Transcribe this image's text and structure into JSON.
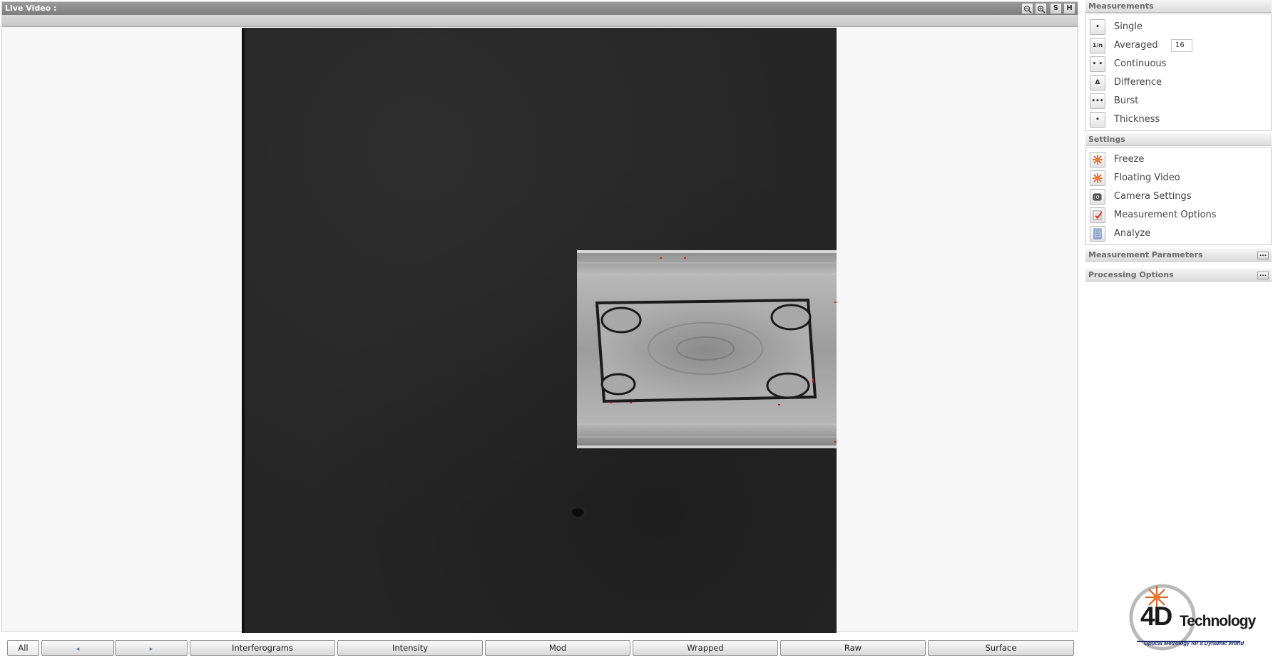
{
  "video": {
    "title": "Live Video :",
    "zoom_out_icon": "zoom-out-icon",
    "zoom_in_icon": "zoom-in-icon",
    "s_label": "S",
    "h_label": "H"
  },
  "tabs": {
    "all": "All",
    "prev": "◂",
    "next": "▸",
    "items": [
      "Interferograms",
      "Intensity",
      "Mod",
      "Wrapped",
      "Raw",
      "Surface"
    ]
  },
  "measurements": {
    "header": "Measurements",
    "items": [
      {
        "label": "Single",
        "icon": "single-dot-icon",
        "glyph": "•"
      },
      {
        "label": "Averaged",
        "icon": "averaged-icon",
        "glyph": "1/n"
      },
      {
        "label": "Continuous",
        "icon": "continuous-icon",
        "glyph": "• •"
      },
      {
        "label": "Difference",
        "icon": "delta-icon",
        "glyph": "Δ"
      },
      {
        "label": "Burst",
        "icon": "burst-icon",
        "glyph": "•••"
      },
      {
        "label": "Thickness",
        "icon": "thickness-icon",
        "glyph": "•"
      }
    ],
    "averaged_count": "16"
  },
  "settings": {
    "header": "Settings",
    "items": [
      {
        "label": "Freeze",
        "icon": "freeze-star-icon"
      },
      {
        "label": "Floating Video",
        "icon": "floating-video-icon"
      },
      {
        "label": "Camera Settings",
        "icon": "camera-icon"
      },
      {
        "label": "Measurement Options",
        "icon": "checklist-icon"
      },
      {
        "label": "Analyze",
        "icon": "analyze-document-icon"
      }
    ]
  },
  "measurement_parameters": {
    "header": "Measurement Parameters",
    "more": "..."
  },
  "processing_options": {
    "header": "Processing Options",
    "more": "..."
  },
  "logo": {
    "brand_main": "4D",
    "brand_sub": "Technology",
    "tagline": "Optical Metrology for a Dynamic World"
  },
  "colors": {
    "accent_star": "#e05a1e",
    "logo_blue": "#1a2a6b",
    "titlebar": "#8a8a8a"
  }
}
